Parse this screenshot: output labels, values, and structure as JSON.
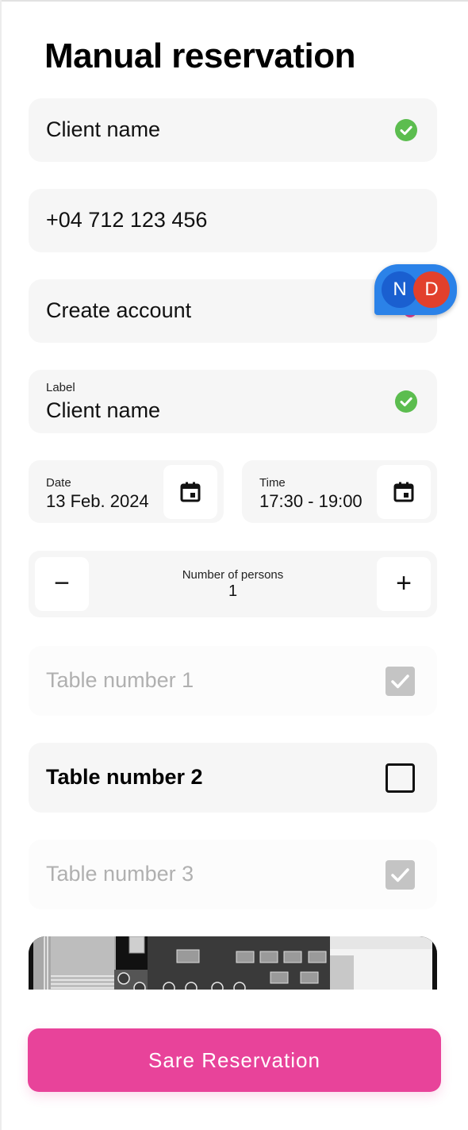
{
  "header": {
    "title": "Manual reservation"
  },
  "form": {
    "client_name": "Client name",
    "phone": "+04 712 123 456",
    "create_account": "Create account",
    "labeled_field": {
      "label": "Label",
      "value": "Client name"
    },
    "date": {
      "label": "Date",
      "value": "13 Feb. 2024"
    },
    "time": {
      "label": "Time",
      "value": "17:30 - 19:00"
    },
    "persons": {
      "label": "Number of persons",
      "value": "1",
      "minus": "−",
      "plus": "+"
    }
  },
  "avatars": [
    {
      "initial": "N",
      "color": "#1a5fd0"
    },
    {
      "initial": "D",
      "color": "#e2402c"
    }
  ],
  "tables": [
    {
      "label": "Table number 1",
      "state": "checked-disabled"
    },
    {
      "label": "Table number 2",
      "state": "unchecked"
    },
    {
      "label": "Table number 3",
      "state": "checked-disabled"
    }
  ],
  "actions": {
    "save_label": "Sare Reservation"
  },
  "colors": {
    "accent": "#e8439a",
    "success": "#5cbd4f",
    "avatar_pill": "#2b82e8"
  }
}
